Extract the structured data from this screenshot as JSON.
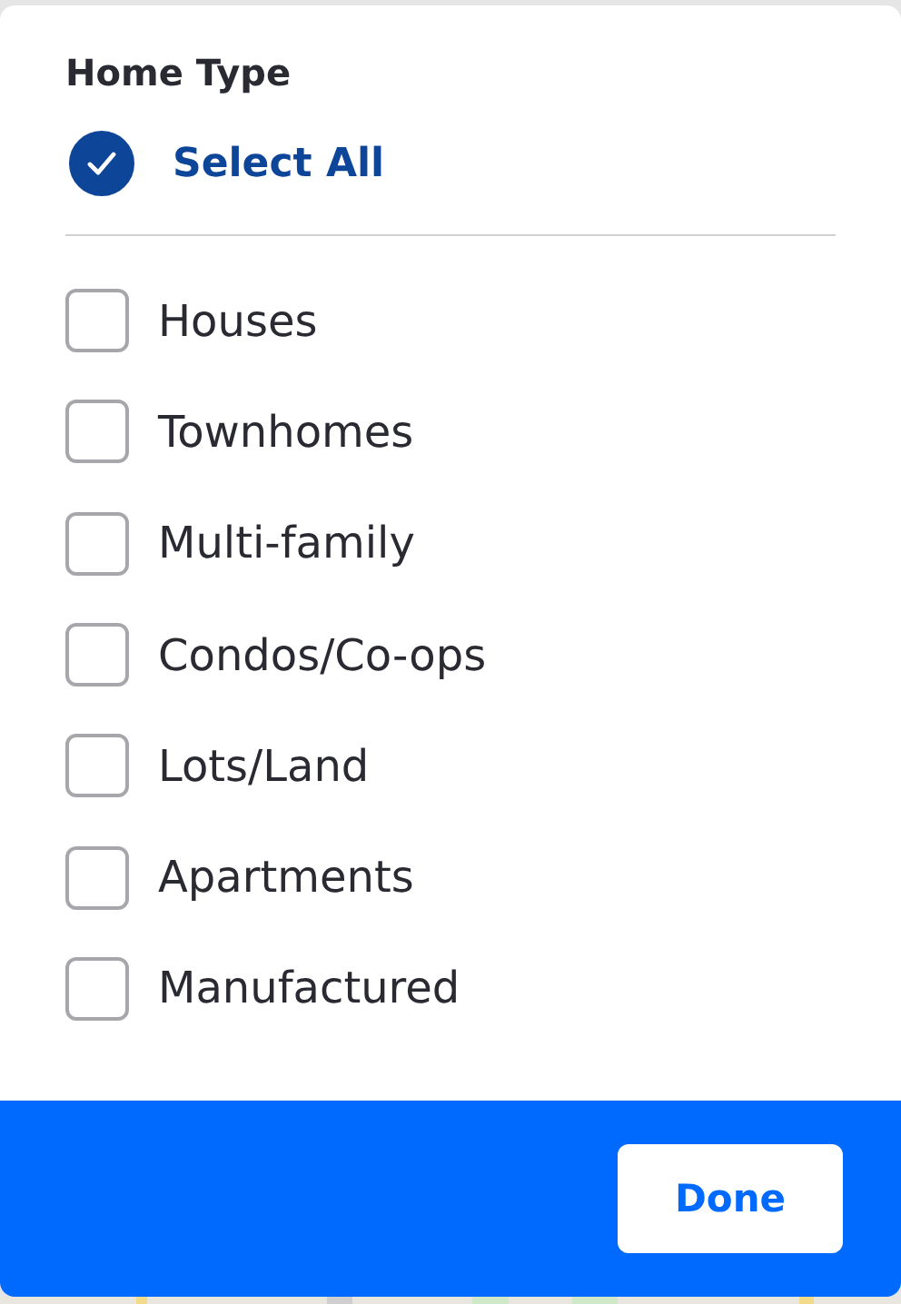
{
  "title": "Home Type",
  "select_all": {
    "label": "Select All",
    "checked": true
  },
  "options": [
    {
      "label": "Houses",
      "checked": false
    },
    {
      "label": "Townhomes",
      "checked": false
    },
    {
      "label": "Multi-family",
      "checked": false
    },
    {
      "label": "Condos/Co-ops",
      "checked": false
    },
    {
      "label": "Lots/Land",
      "checked": false
    },
    {
      "label": "Apartments",
      "checked": false
    },
    {
      "label": "Manufactured",
      "checked": false
    }
  ],
  "footer": {
    "button": "Done"
  }
}
